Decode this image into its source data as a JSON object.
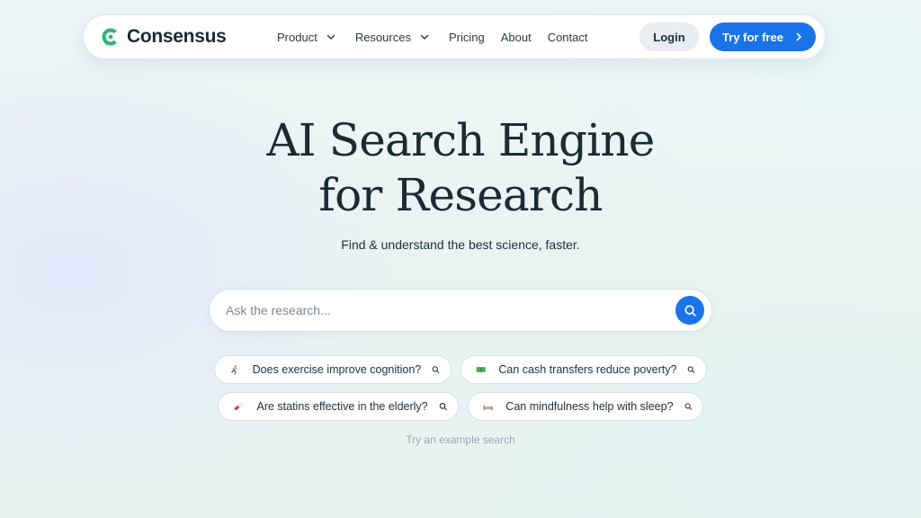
{
  "brand": {
    "name": "Consensus",
    "logo_icon": "consensus-logo-icon",
    "logo_color": "#2bb673"
  },
  "nav": {
    "items": [
      {
        "label": "Product",
        "has_dropdown": true
      },
      {
        "label": "Resources",
        "has_dropdown": true
      },
      {
        "label": "Pricing",
        "has_dropdown": false
      },
      {
        "label": "About",
        "has_dropdown": false
      },
      {
        "label": "Contact",
        "has_dropdown": false
      }
    ],
    "login_label": "Login",
    "cta_label": "Try for free",
    "cta_color": "#1a73e8"
  },
  "hero": {
    "title_line1": "AI Search Engine",
    "title_line2": "for Research",
    "subtitle": "Find & understand the best science, faster."
  },
  "search": {
    "placeholder": "Ask the research...",
    "value": "",
    "button_icon": "search-icon"
  },
  "examples": {
    "items": [
      {
        "icon": "running-person-icon",
        "label": "Does exercise improve cognition?"
      },
      {
        "icon": "money-icon",
        "label": "Can cash transfers reduce poverty?"
      },
      {
        "icon": "pill-icon",
        "label": "Are statins effective in the elderly?"
      },
      {
        "icon": "bed-icon",
        "label": "Can mindfulness help with sleep?"
      }
    ],
    "hint": "Try an example search"
  }
}
